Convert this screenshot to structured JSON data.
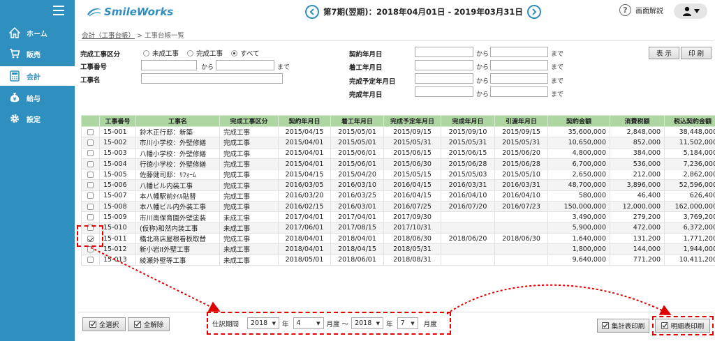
{
  "app": {
    "logo": "SmileWorks",
    "period": "第7期(翌期)：2018年04月01日 - 2019年03月31日",
    "help": "画面解説"
  },
  "sidebar": {
    "items": [
      {
        "label": "ホーム",
        "icon": "home-icon"
      },
      {
        "label": "販売",
        "icon": "cart-icon"
      },
      {
        "label": "会計",
        "icon": "calculator-icon"
      },
      {
        "label": "給与",
        "icon": "money-bag-icon"
      },
      {
        "label": "設定",
        "icon": "gear-icon"
      }
    ],
    "active": "会計"
  },
  "breadcrumb": {
    "link": "会計（工事台帳）",
    "sep": ">",
    "current": "工事台帳一覧"
  },
  "filters": {
    "completion_label": "完成工事区分",
    "completion_options": [
      "未成工事",
      "完成工事",
      "すべて"
    ],
    "completion_selected": "すべて",
    "project_no_label": "工事番号",
    "project_name_label": "工事名",
    "contract_date_label": "契約年月日",
    "start_date_label": "着工年月日",
    "planned_completion_label": "完成予定年月日",
    "completion_date_label": "完成年月日",
    "from": "から",
    "to": "まで"
  },
  "toolbar": {
    "display": "表 示",
    "print": "印 刷"
  },
  "table": {
    "columns": [
      "",
      "工事番号",
      "工事名",
      "完成工事区分",
      "契約年月日",
      "着工年月日",
      "完成予定年月日",
      "完成年月日",
      "引渡年月日",
      "契約金額",
      "消費税額",
      "税込契約金額"
    ],
    "rows": [
      {
        "checked": false,
        "no": "15-001",
        "name": "鈴木正行邸：新築",
        "status": "完成工事",
        "contract": "2015/04/15",
        "start": "2015/05/01",
        "planned": "2015/09/15",
        "completed": "2015/09/10",
        "delivered": "2015/09/15",
        "amount": "35,600,000",
        "tax": "2,848,000",
        "total": "38,448,000"
      },
      {
        "checked": false,
        "no": "15-002",
        "name": "市川小学校：外壁修繕",
        "status": "完成工事",
        "contract": "2015/04/01",
        "start": "2015/05/01",
        "planned": "2015/05/31",
        "completed": "2015/05/31",
        "delivered": "2015/05/31",
        "amount": "10,650,000",
        "tax": "852,000",
        "total": "11,502,000"
      },
      {
        "checked": false,
        "no": "15-003",
        "name": "八幡小学校：外壁修繕",
        "status": "完成工事",
        "contract": "2015/04/01",
        "start": "2015/06/01",
        "planned": "2015/06/15",
        "completed": "2015/06/15",
        "delivered": "2015/06/20",
        "amount": "4,800,000",
        "tax": "384,000",
        "total": "5,184,000"
      },
      {
        "checked": false,
        "no": "15-004",
        "name": "行徳小学校：外壁修繕",
        "status": "完成工事",
        "contract": "2015/04/01",
        "start": "2015/06/01",
        "planned": "2015/06/30",
        "completed": "2015/06/28",
        "delivered": "2015/06/28",
        "amount": "6,700,000",
        "tax": "536,000",
        "total": "7,236,000"
      },
      {
        "checked": false,
        "no": "15-005",
        "name": "佐藤健司邸：ﾘﾌｫｰﾑ",
        "status": "完成工事",
        "contract": "2015/04/15",
        "start": "2015/04/20",
        "planned": "2015/05/15",
        "completed": "2015/05/03",
        "delivered": "2015/05/10",
        "amount": "2,650,000",
        "tax": "212,000",
        "total": "2,862,000"
      },
      {
        "checked": false,
        "no": "15-006",
        "name": "八幡ビル内装工事",
        "status": "完成工事",
        "contract": "2016/03/05",
        "start": "2016/03/10",
        "planned": "2016/04/15",
        "completed": "2016/03/31",
        "delivered": "2016/03/31",
        "amount": "48,700,000",
        "tax": "3,896,000",
        "total": "52,596,000"
      },
      {
        "checked": false,
        "no": "15-007",
        "name": "本八幡駅前ﾀｲﾙ貼替",
        "status": "完成工事",
        "contract": "2016/03/20",
        "start": "2016/03/25",
        "planned": "2016/04/15",
        "completed": "2016/04/10",
        "delivered": "2016/04/10",
        "amount": "580,000",
        "tax": "46,400",
        "total": "626,400"
      },
      {
        "checked": false,
        "no": "15-008",
        "name": "本八幡ビル内外装工事",
        "status": "完成工事",
        "contract": "2016/02/15",
        "start": "2016/03/01",
        "planned": "2016/07/25",
        "completed": "2016/07/20",
        "delivered": "2016/07/23",
        "amount": "150,000,000",
        "tax": "12,000,000",
        "total": "162,000,000"
      },
      {
        "checked": false,
        "no": "15-009",
        "name": "市川南保育園外壁塗装",
        "status": "未成工事",
        "contract": "2017/04/01",
        "start": "2017/04/01",
        "planned": "2017/09/30",
        "completed": "",
        "delivered": "",
        "amount": "3,490,000",
        "tax": "279,200",
        "total": "3,769,200"
      },
      {
        "checked": false,
        "no": "15-010",
        "name": "(仮称)和然内装工事",
        "status": "未成工事",
        "contract": "2017/06/01",
        "start": "2017/08/15",
        "planned": "2017/10/31",
        "completed": "",
        "delivered": "",
        "amount": "5,900,000",
        "tax": "472,000",
        "total": "6,372,000"
      },
      {
        "checked": true,
        "no": "15-011",
        "name": "橋北商店屋根看板取替",
        "status": "完成工事",
        "contract": "2018/04/01",
        "start": "2018/04/01",
        "planned": "2018/06/30",
        "completed": "2018/06/20",
        "delivered": "2018/06/30",
        "amount": "1,640,000",
        "tax": "131,200",
        "total": "1,771,200"
      },
      {
        "checked": false,
        "no": "15-012",
        "name": "新小岩II外壁工事",
        "status": "未成工事",
        "contract": "2018/04/01",
        "start": "2018/04/15",
        "planned": "2018/05/31",
        "completed": "",
        "delivered": "",
        "amount": "1,800,000",
        "tax": "144,000",
        "total": "1,944,000"
      },
      {
        "checked": false,
        "no": "15-013",
        "name": "綾瀬外壁等工事",
        "status": "未成工事",
        "contract": "2018/05/01",
        "start": "2018/06/01",
        "planned": "2018/08/31",
        "completed": "",
        "delivered": "",
        "amount": "9,640,000",
        "tax": "771,200",
        "total": "10,411,200"
      }
    ]
  },
  "footer": {
    "select_all": "全選択",
    "deselect_all": "全解除",
    "period_label": "仕訳期間",
    "from_year": "2018",
    "year_unit": "年",
    "from_month": "4",
    "month_unit_from": "月度 〜",
    "to_year": "2018",
    "to_month": "7",
    "month_unit_to": "月度",
    "summary_print": "集計表印刷",
    "detail_print": "明細表印刷"
  },
  "colors": {
    "sidebar": "#2f8fbf",
    "table_header": "#aed6a3",
    "annotation": "#e00000"
  }
}
